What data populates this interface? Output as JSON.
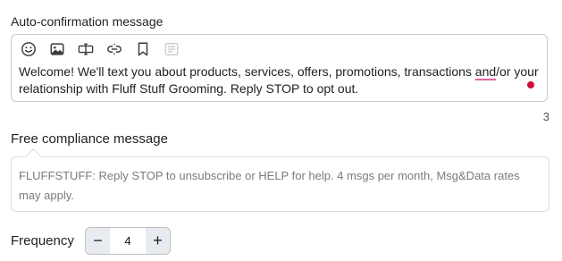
{
  "auto_confirmation": {
    "label": "Auto-confirmation message",
    "toolbar": [
      "emoji-icon",
      "image-icon",
      "text-field-icon",
      "link-icon",
      "bookmark-icon",
      "card-icon"
    ],
    "text_before": "Welcome! We'll text you about products, services, offers, promotions, transactions ",
    "text_flagged": "and",
    "text_after": "/or your relationship with Fluff Stuff Grooming. Reply STOP to opt out.",
    "counter": "3"
  },
  "compliance": {
    "label": "Free compliance message",
    "text": "FLUFFSTUFF: Reply STOP to unsubscribe or HELP for help. 4 msgs per month, Msg&Data rates may apply."
  },
  "frequency": {
    "label": "Frequency",
    "minus": "−",
    "value": "4",
    "plus": "+"
  }
}
